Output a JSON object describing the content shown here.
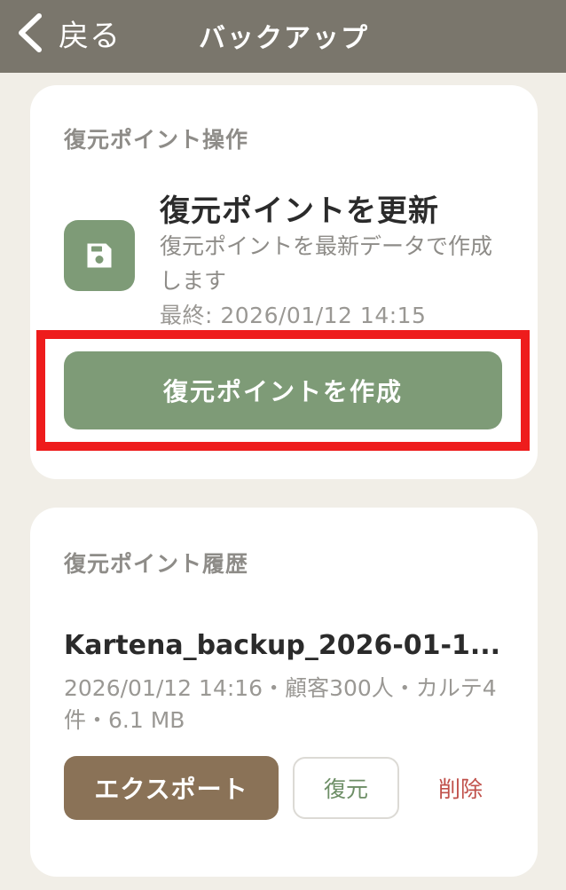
{
  "nav": {
    "back_label": "戻る",
    "title": "バックアップ"
  },
  "restore_ops": {
    "section_title": "復元ポイント操作",
    "icon": "floppy-disk-icon",
    "refresh_title": "復元ポイントを更新",
    "refresh_description": "復元ポイントを最新データで作成します",
    "last_updated": "最終: 2026/01/12 14:15",
    "create_button": "復元ポイントを作成"
  },
  "history": {
    "section_title": "復元ポイント履歴",
    "items": [
      {
        "file_name": "Kartena_backup_2026-01-1...",
        "meta": "2026/01/12 14:16・顧客300人・カルテ4件・6.1 MB",
        "export_label": "エクスポート",
        "restore_label": "復元",
        "delete_label": "削除"
      }
    ]
  },
  "colors": {
    "nav_bg": "#7a766c",
    "page_bg": "#f1eee7",
    "accent_green": "#7e9b77",
    "export_brown": "#8a7257",
    "delete_red": "#c0504a",
    "highlight_red": "#ee1c1c"
  }
}
